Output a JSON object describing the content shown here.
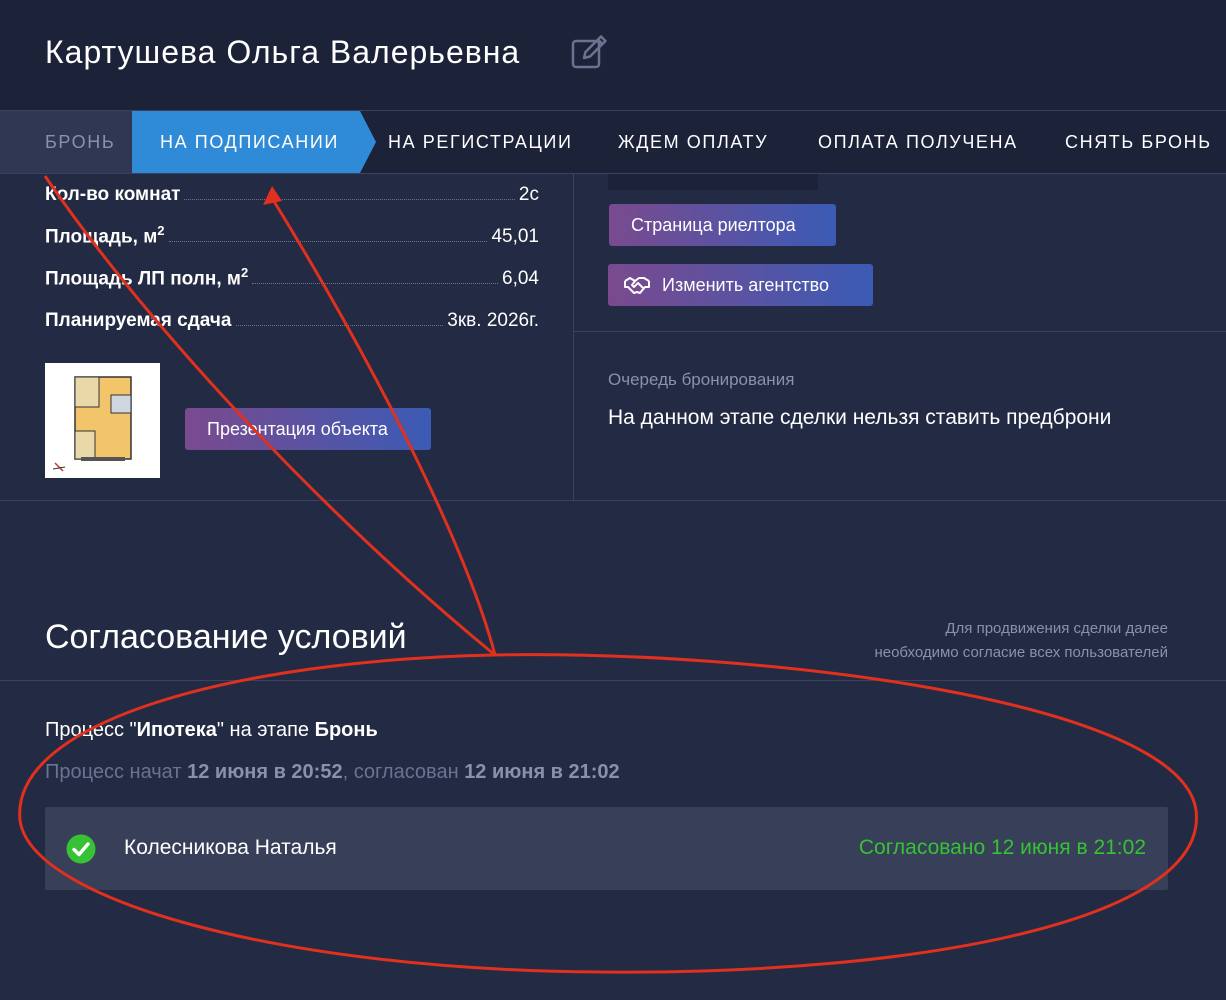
{
  "header": {
    "client_name": "Картушева Ольга Валерьевна",
    "edit_icon": "pencil-square-icon"
  },
  "tabs": [
    {
      "label": "БРОНЬ",
      "state": "done"
    },
    {
      "label": "НА ПОДПИСАНИИ",
      "state": "active"
    },
    {
      "label": "НА РЕГИСТРАЦИИ",
      "state": "pending"
    },
    {
      "label": "ЖДЕМ ОПЛАТУ",
      "state": "pending"
    },
    {
      "label": "ОПЛАТА ПОЛУЧЕНА",
      "state": "pending"
    },
    {
      "label": "СНЯТЬ БРОНЬ",
      "state": "pending"
    }
  ],
  "property": {
    "rooms_label": "Кол-во комнат",
    "rooms_value": "2с",
    "area_label": "Площадь, м",
    "area_sup": "2",
    "area_value": "45,01",
    "balcony_label": "Площадь ЛП полн, м",
    "balcony_sup": "2",
    "balcony_value": "6,04",
    "delivery_label": "Планируемая сдача",
    "delivery_value": "3кв. 2026г.",
    "presentation_button": "Презентация объекта"
  },
  "realtor": {
    "realtor_page_button": "Страница риелтора",
    "change_agency_button": "Изменить агентство",
    "change_agency_icon": "handshake-icon"
  },
  "queue": {
    "label": "Очередь бронирования",
    "text": "На данном этапе сделки нельзя ставить предброни"
  },
  "agreement": {
    "title": "Согласование условий",
    "note_line1": "Для продвижения сделки далее",
    "note_line2": "необходимо согласие всех пользователей",
    "process_prefix": "Процесс \"",
    "process_name": "Ипотека",
    "process_middle": "\" на этапе ",
    "process_stage": "Бронь",
    "started_prefix": "Процесс начат ",
    "started_at": "12 июня в 20:52",
    "approved_prefix": ", согласован ",
    "approved_at": "12 июня в 21:02",
    "approvals": [
      {
        "name": "Колесникова Наталья",
        "status": "Согласовано 12 июня в 21:02",
        "icon": "green-check-icon"
      }
    ]
  },
  "colors": {
    "background": "#232a43",
    "header": "#1c2238",
    "active_tab": "#2f8ad8",
    "approved": "#36c234",
    "annotation": "#e0301e"
  }
}
